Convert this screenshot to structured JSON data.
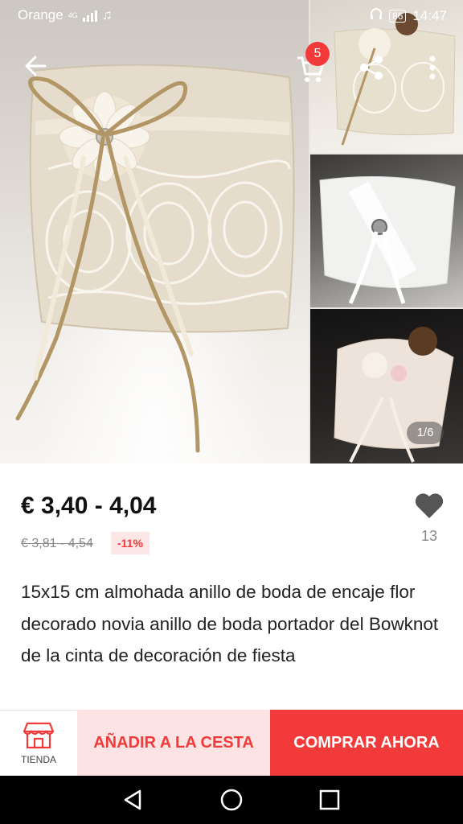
{
  "status_bar": {
    "carrier": "Orange",
    "network": "4G",
    "battery": "86",
    "time": "14:47"
  },
  "gallery": {
    "page_indicator": "1/6",
    "cart_badge": "5"
  },
  "product": {
    "price": "€ 3,40 - 4,04",
    "original_price": "€ 3,81 - 4,54",
    "discount": "-11%",
    "wishlist_count": "13",
    "title": "15x15 cm almohada anillo de boda de encaje flor decorado novia anillo de boda portador del Bowknot de la cinta de decoración de fiesta"
  },
  "action_bar": {
    "store_label": "TIENDA",
    "add_to_cart_label": "AÑADIR A LA CESTA",
    "buy_now_label": "COMPRAR AHORA"
  },
  "icons": {
    "back": "arrow-left-icon",
    "cart": "cart-icon",
    "share": "share-icon",
    "more": "more-vertical-icon",
    "wishlist": "heart-icon",
    "store": "store-icon",
    "nav_back": "triangle-back-icon",
    "nav_home": "circle-home-icon",
    "nav_recent": "square-recent-icon"
  },
  "colors": {
    "accent": "#f23a3a",
    "accent_light": "#fde3e3",
    "text": "#222222",
    "muted": "#888888"
  }
}
